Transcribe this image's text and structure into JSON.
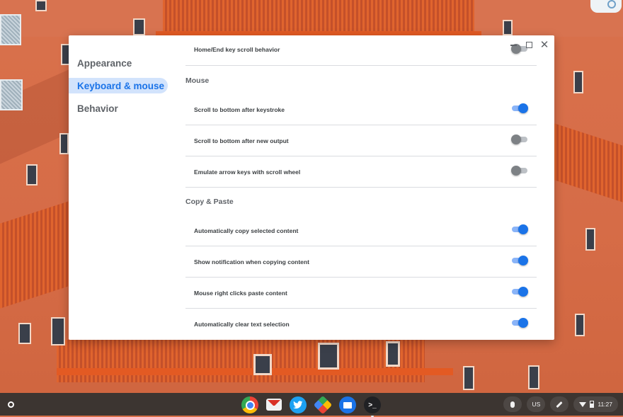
{
  "window": {
    "controls": {
      "minimize": "",
      "maximize": "",
      "close": "✕"
    }
  },
  "sidebar": {
    "items": [
      {
        "label": "Appearance",
        "active": false
      },
      {
        "label": "Keyboard & mouse",
        "active": true
      },
      {
        "label": "Behavior",
        "active": false
      }
    ]
  },
  "settings": {
    "top_row": {
      "label": "Home/End key scroll behavior",
      "enabled": false
    },
    "mouse": {
      "title": "Mouse",
      "rows": [
        {
          "label": "Scroll to bottom after keystroke",
          "enabled": true
        },
        {
          "label": "Scroll to bottom after new output",
          "enabled": false
        },
        {
          "label": "Emulate arrow keys with scroll wheel",
          "enabled": false
        }
      ]
    },
    "copy_paste": {
      "title": "Copy & Paste",
      "rows": [
        {
          "label": "Automatically copy selected content",
          "enabled": true
        },
        {
          "label": "Show notification when copying content",
          "enabled": true
        },
        {
          "label": "Mouse right clicks paste content",
          "enabled": true
        },
        {
          "label": "Automatically clear text selection",
          "enabled": true
        }
      ]
    }
  },
  "shelf": {
    "apps": [
      "chrome-icon",
      "gmail-icon",
      "twitter-icon",
      "photos-icon",
      "files-icon",
      "terminal-icon"
    ],
    "terminal_glyph": ">_",
    "tray": {
      "keyboard_layout": "US",
      "time": "11:27"
    }
  },
  "colors": {
    "accent": "#1a73e8",
    "active_nav_bg": "#d2e3fc",
    "toggle_track_on": "#8ab4f8",
    "toggle_off": "#7d8185",
    "shelf": "#3c3531"
  }
}
